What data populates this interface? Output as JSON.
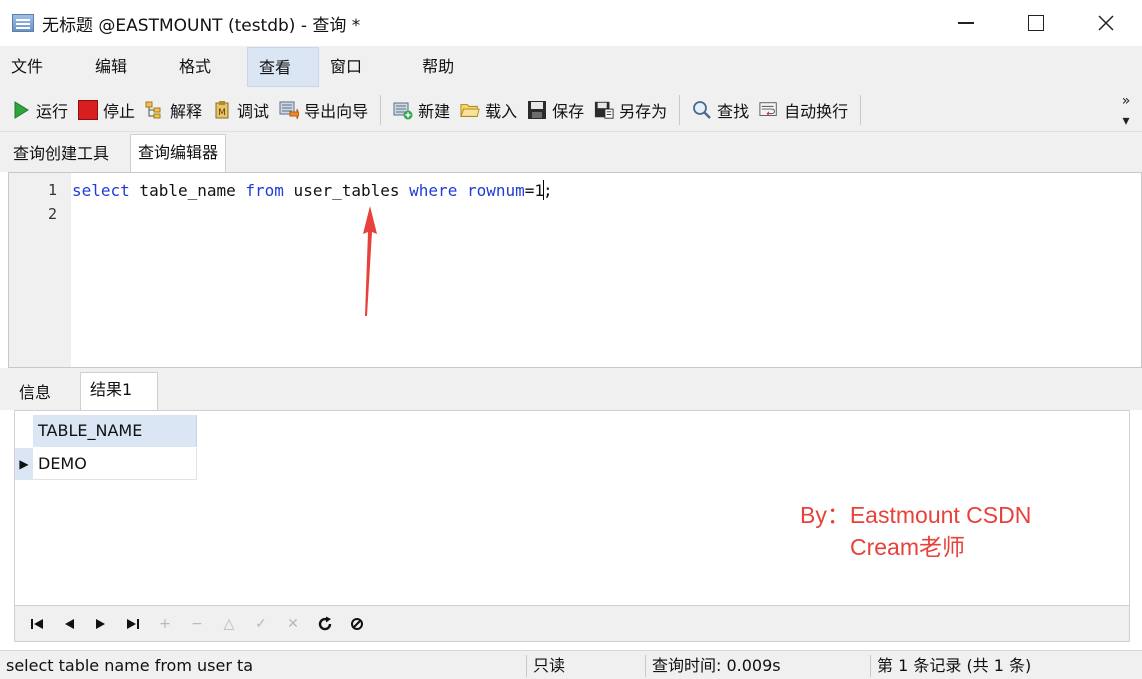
{
  "window": {
    "title": "无标题 @EASTMOUNT (testdb) - 查询 *",
    "minimize_icon": "minimize-icon",
    "maximize_icon": "maximize-icon",
    "close_icon": "close-icon"
  },
  "menu": {
    "items": [
      "文件",
      "编辑",
      "格式",
      "查看",
      "窗口",
      "帮助"
    ],
    "active": "查看"
  },
  "toolbar": {
    "run": "运行",
    "stop": "停止",
    "explain": "解释",
    "debug": "调试",
    "export_wizard": "导出向导",
    "new": "新建",
    "load": "载入",
    "save": "保存",
    "save_as": "另存为",
    "find": "查找",
    "word_wrap": "自动换行"
  },
  "editor_tabs": [
    "查询创建工具",
    "查询编辑器"
  ],
  "editor": {
    "line_numbers": [
      "1",
      "2"
    ],
    "code": {
      "kw_select": "select",
      "ident_table": " table_name ",
      "kw_from": "from",
      "ident_user_tables": " user_tables ",
      "kw_where": "where",
      "kw_rownum": " rownum",
      "op_eq": "=",
      "num": "1",
      "semi": ";"
    }
  },
  "result_tabs": [
    "信息",
    "结果1"
  ],
  "grid": {
    "columns": [
      "TABLE_NAME"
    ],
    "rows": [
      [
        "DEMO"
      ]
    ]
  },
  "watermark": {
    "line1": "By：Eastmount CSDN",
    "line2": "Cream老师"
  },
  "navigator": {
    "first": "⏮",
    "prev": "◀",
    "next": "▶",
    "last": "⏭",
    "add": "+",
    "delete": "−",
    "edit": "△",
    "apply": "✓",
    "cancel": "✕",
    "refresh": "⟳",
    "stop": "⊘"
  },
  "status": {
    "sql_preview": "select table name from user ta",
    "mode": "只读",
    "query_time": "查询时间: 0.009s",
    "record": "第 1 条记录 (共 1 条)"
  },
  "colors": {
    "keyword": "#1f3dd6",
    "watermark": "#e8413b",
    "arrow": "#e8413b",
    "header_bg": "#dbe6f4"
  }
}
